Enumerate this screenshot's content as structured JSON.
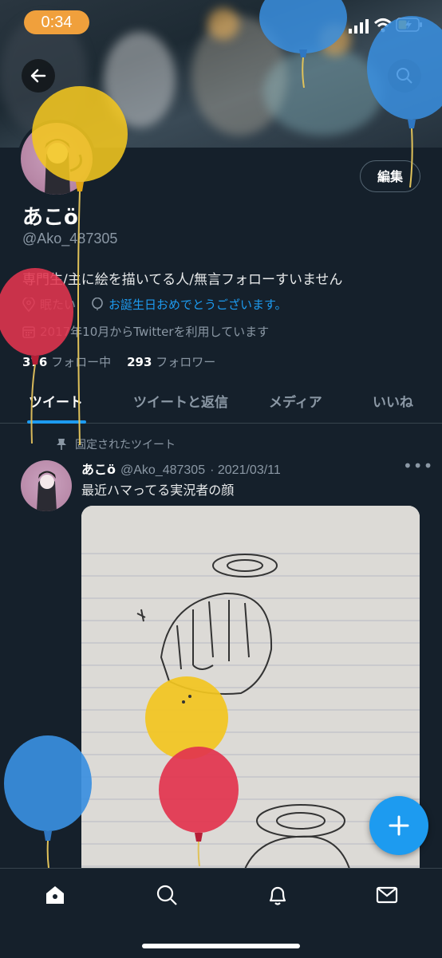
{
  "status_bar": {
    "time": "0:34"
  },
  "profile": {
    "display_name": "あこö",
    "handle": "@Ako_487305",
    "edit_label": "編集",
    "bio": "専門生/主に絵を描いてる人/無言フォローすいません",
    "location": "眠たい",
    "birthday": "お誕生日おめでとうございます。",
    "joined": "2017年10月からTwitterを利用しています",
    "following_count": "376",
    "following_label": "フォロー中",
    "followers_count": "293",
    "followers_label": "フォロワー"
  },
  "tabs": [
    {
      "label": "ツイート",
      "active": true
    },
    {
      "label": "ツイートと返信",
      "active": false
    },
    {
      "label": "メディア",
      "active": false
    },
    {
      "label": "いいね",
      "active": false
    }
  ],
  "pinned_tweet": {
    "pinned_label": "固定されたツイート",
    "name": "あこö",
    "handle": "@Ako_487305",
    "date": "· 2021/03/11",
    "more": "•••",
    "text": "最近ハマってる実況者の顔"
  },
  "icons": {
    "back": "arrow-left-icon",
    "search": "search-icon",
    "compose": "plus-icon",
    "nav": [
      "home-icon",
      "search-icon",
      "bell-icon",
      "mail-icon"
    ]
  },
  "colors": {
    "background": "#15202b",
    "accent": "#1d9bf0",
    "time_pill": "#f0a03c",
    "balloon_yellow": "#f2c61f",
    "balloon_red": "#e2344e",
    "balloon_blue": "#3a8fe0"
  }
}
